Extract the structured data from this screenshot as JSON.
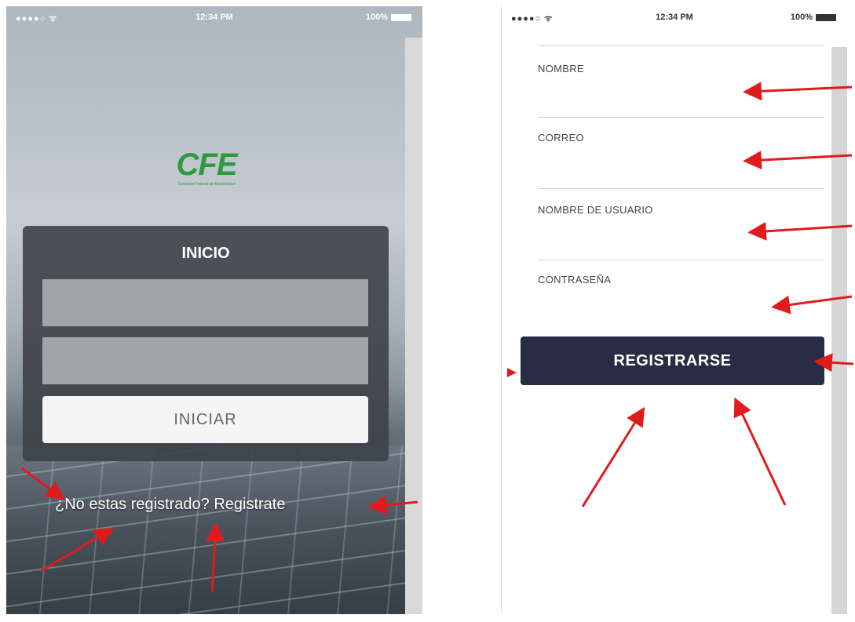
{
  "login_screen": {
    "status_bar": {
      "signal": "●●●●○",
      "wifi": "ᯤ",
      "time": "12:34 PM",
      "battery": "100%"
    },
    "logo": {
      "text": "CFE",
      "subtitle": "Comisión Federal de Electricidad"
    },
    "card_title": "INICIO",
    "username_value": "",
    "password_value": "",
    "login_button": "INICIAR",
    "register_prompt": "¿No estas registrado? Registrate"
  },
  "register_screen": {
    "status_bar": {
      "signal": "●●●●○",
      "wifi": "ᯤ",
      "time": "12:34 PM",
      "battery": "100%"
    },
    "fields": [
      {
        "label": "NOMBRE",
        "value": ""
      },
      {
        "label": "CORREO",
        "value": ""
      },
      {
        "label": "NOMBRE DE USUARIO",
        "value": ""
      },
      {
        "label": "CONTRASEÑA",
        "value": ""
      }
    ],
    "submit_button": "REGISTRARSE"
  },
  "colors": {
    "logo_green": "#2e9a3e",
    "submit_navy": "#2a2b45",
    "annotation_red": "#e01b1b"
  },
  "icons": [
    "signal-icon",
    "wifi-icon",
    "battery-icon",
    "annotation-arrow"
  ]
}
